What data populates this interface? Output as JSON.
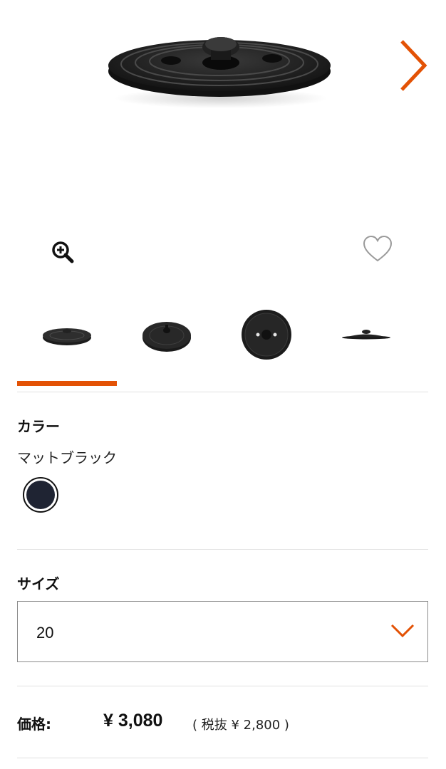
{
  "product": {
    "icons": {
      "next": "chevron-right-icon",
      "zoom": "zoom-in-icon",
      "favorite": "heart-outline-icon",
      "dropdown": "chevron-down-icon"
    }
  },
  "thumbnails": [
    {
      "label": "side-view"
    },
    {
      "label": "angled-top-view"
    },
    {
      "label": "top-view"
    },
    {
      "label": "profile-view"
    }
  ],
  "color": {
    "title": "カラー",
    "selected_name": "マットブラック",
    "swatch_hex": "#1f2433"
  },
  "size": {
    "title": "サイズ",
    "selected_value": "20"
  },
  "price": {
    "label": "価格:",
    "value": "¥ 3,080",
    "tax_excluded": "( 税抜 ¥ 2,800 )"
  },
  "accent_color": "#e35205"
}
